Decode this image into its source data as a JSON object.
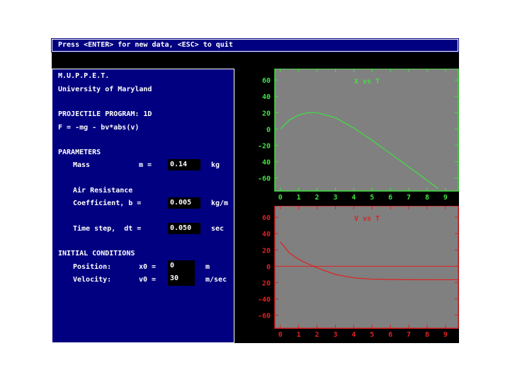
{
  "header": {
    "prompt": "Press <ENTER> for new data, <ESC> to quit"
  },
  "panel": {
    "title": "M.U.P.P.E.T.",
    "institution": "University of Maryland",
    "program": "PROJECTILE PROGRAM: 1D",
    "force_law": "F = -mg - bv*abs(v)",
    "parameters_heading": "PARAMETERS",
    "mass": {
      "label": "Mass",
      "symbol": "m =",
      "value": "0.14",
      "unit": "kg"
    },
    "air_resistance_label": "Air Resistance",
    "drag": {
      "label": "Coefficient, b =",
      "value": "0.005",
      "unit": "kg/m"
    },
    "timestep": {
      "label": "Time step,  dt =",
      "value": "0.050",
      "unit": "sec"
    },
    "initial_heading": "INITIAL CONDITIONS",
    "position": {
      "label": "Position:",
      "symbol": "x0 =",
      "value": "0",
      "unit": "m"
    },
    "velocity": {
      "label": "Velocity:",
      "symbol": "v0 =",
      "value": "30",
      "unit": "m/sec"
    }
  },
  "chart_data": [
    {
      "type": "line",
      "title": "X vs T",
      "color": "#40e040",
      "background": "#808080",
      "xlim": [
        -0.3,
        9.7
      ],
      "ylim": [
        -76,
        74
      ],
      "x_ticks": [
        0,
        1,
        2,
        3,
        4,
        5,
        6,
        7,
        8,
        9
      ],
      "x_tick_labels": [
        "0",
        "1",
        "2",
        "3",
        "4",
        "5",
        "6",
        "7",
        "8",
        "9"
      ],
      "y_ticks": [
        60,
        40,
        20,
        0,
        -20,
        -40,
        -60
      ],
      "y_tick_labels": [
        "60",
        "40",
        "20",
        "0",
        "-20",
        "40",
        "-60"
      ],
      "x": [
        0,
        0.5,
        1,
        1.5,
        1.8,
        2,
        3,
        4,
        5,
        6,
        7,
        8,
        8.6
      ],
      "y": [
        0,
        11.1,
        17.1,
        19.9,
        20.3,
        20.1,
        13.8,
        1.3,
        -13.9,
        -30.0,
        -46.4,
        -62.9,
        -73
      ]
    },
    {
      "type": "line",
      "title": "V vs T",
      "color": "#e02020",
      "background": "#808080",
      "xlim": [
        -0.3,
        9.7
      ],
      "ylim": [
        -76,
        74
      ],
      "zero_line": true,
      "x_ticks": [
        0,
        1,
        2,
        3,
        4,
        5,
        6,
        7,
        8,
        9
      ],
      "x_tick_labels": [
        "0",
        "1",
        "2",
        "3",
        "4",
        "5",
        "6",
        "7",
        "8",
        "9"
      ],
      "y_ticks": [
        60,
        40,
        20,
        0,
        -20,
        -40,
        -60
      ],
      "y_tick_labels": [
        "60",
        "40",
        "20",
        "0",
        "20",
        "-40",
        "-60"
      ],
      "x": [
        0,
        0.5,
        1,
        1.5,
        1.8,
        2,
        3,
        4,
        5,
        6,
        7,
        8,
        9,
        9.7
      ],
      "y": [
        30,
        16.1,
        8.5,
        3.0,
        0,
        -1.95,
        -10.1,
        -14.3,
        -15.8,
        -16.3,
        -16.5,
        -16.55,
        -16.56,
        -16.56
      ]
    }
  ]
}
